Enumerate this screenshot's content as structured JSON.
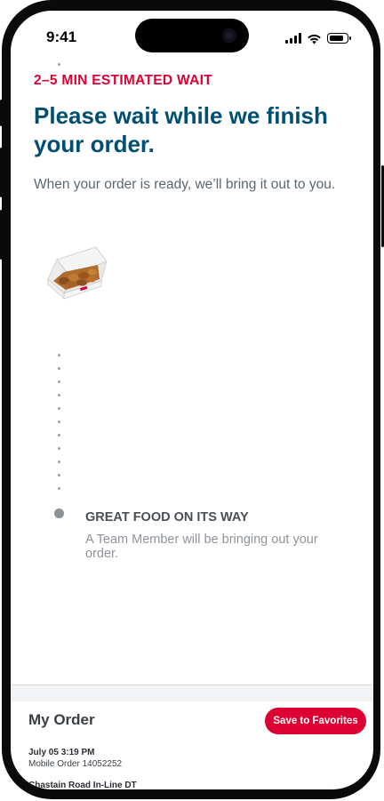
{
  "status_bar": {
    "time": "9:41"
  },
  "order_status": {
    "wait_label": "2–5 MIN ESTIMATED WAIT",
    "title": "Please wait while we finish your order.",
    "subtitle": "When your order is ready, we’ll bring it out to you."
  },
  "step": {
    "title": "GREAT FOOD ON ITS WAY",
    "description": "A Team Member will be bringing out your order."
  },
  "my_order": {
    "title": "My Order",
    "favorites_button": "Save to Favorites",
    "date": "July 05 3:19 PM",
    "order_number": "Mobile Order 14052252",
    "location": "Chastain Road In-Line DT"
  },
  "colors": {
    "accent_red": "#dd0033",
    "title_blue": "#004f71"
  },
  "icons": [
    "signal-icon",
    "wifi-icon",
    "battery-icon",
    "food-box-icon"
  ]
}
